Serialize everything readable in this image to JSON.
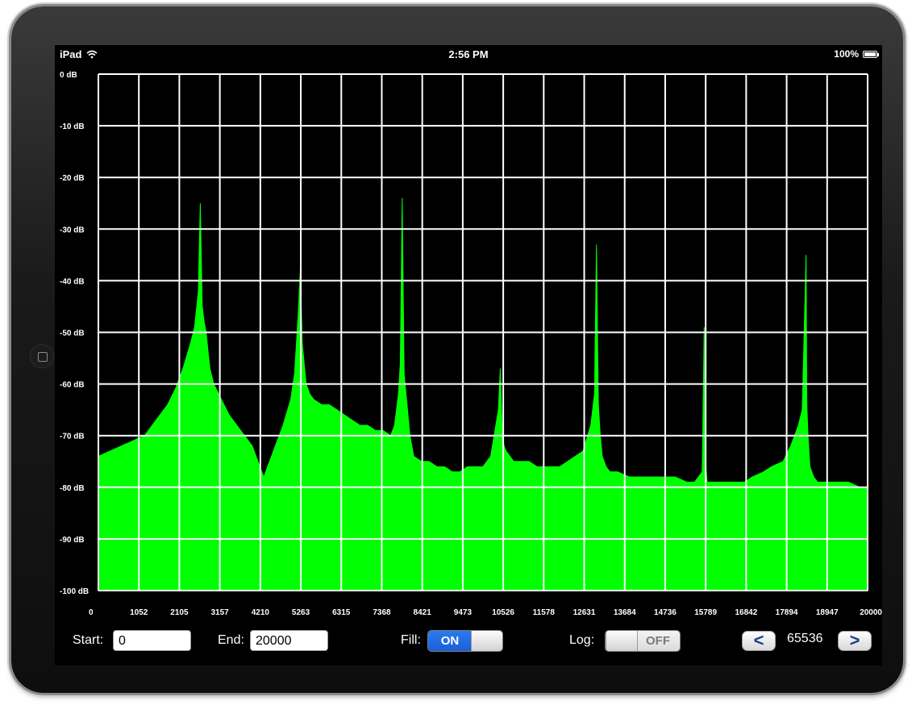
{
  "status_bar": {
    "device": "iPad",
    "time": "2:56 PM",
    "battery": "100%"
  },
  "colors": {
    "spectrum_fill": "#00ff00",
    "grid": "#ffffff",
    "background": "#000000",
    "switch_on": "#1f6ee0"
  },
  "chart_data": {
    "type": "area",
    "title": "",
    "xlabel": "",
    "ylabel": "",
    "xlim": [
      0,
      20000
    ],
    "ylim": [
      -100,
      0
    ],
    "x_ticks": [
      "0",
      "1052",
      "2105",
      "3157",
      "4210",
      "5263",
      "6315",
      "7368",
      "8421",
      "9473",
      "10526",
      "11578",
      "12631",
      "13684",
      "14736",
      "15789",
      "16842",
      "17894",
      "18947",
      "20000"
    ],
    "y_ticks": [
      "0 dB",
      "-10 dB",
      "-20 dB",
      "-30 dB",
      "-40 dB",
      "-50 dB",
      "-60 dB",
      "-70 dB",
      "-80 dB",
      "-90 dB",
      "-100 dB"
    ],
    "grid": true,
    "fill": true,
    "series": [
      {
        "x": [
          0,
          300,
          600,
          900,
          1200,
          1500,
          1800,
          2000,
          2200,
          2400,
          2500,
          2600,
          2650,
          2700,
          2750,
          2800,
          2900,
          3000,
          3200,
          3400,
          3600,
          3800,
          4000,
          4200,
          4300,
          4400,
          4600,
          4800,
          5000,
          5100,
          5200,
          5250,
          5300,
          5350,
          5400,
          5500,
          5600,
          5800,
          6000,
          6200,
          6400,
          6600,
          6800,
          7000,
          7200,
          7400,
          7600,
          7700,
          7800,
          7850,
          7900,
          7950,
          8000,
          8100,
          8200,
          8400,
          8600,
          8800,
          9000,
          9200,
          9400,
          9600,
          9800,
          10000,
          10200,
          10400,
          10450,
          10500,
          10550,
          10600,
          10700,
          10800,
          11000,
          11200,
          11400,
          11600,
          11800,
          12000,
          12200,
          12400,
          12600,
          12800,
          12900,
          12950,
          13000,
          13050,
          13100,
          13200,
          13300,
          13500,
          13800,
          14000,
          14200,
          14500,
          14800,
          15000,
          15300,
          15500,
          15700,
          15750,
          15790,
          15830,
          15900,
          16200,
          16500,
          16800,
          17000,
          17300,
          17500,
          17800,
          18000,
          18200,
          18300,
          18400,
          18420,
          18450,
          18500,
          18600,
          18700,
          18800,
          19000,
          19300,
          19500,
          19800,
          20000
        ],
        "values": [
          -74,
          -73,
          -72,
          -71,
          -70,
          -67,
          -64,
          -61,
          -57,
          -52,
          -49,
          -42,
          -25,
          -45,
          -48,
          -50,
          -57,
          -60,
          -63,
          -66,
          -68,
          -70,
          -72,
          -76,
          -78,
          -76,
          -72,
          -68,
          -63,
          -58,
          -46,
          -38,
          -52,
          -56,
          -60,
          -62,
          -63,
          -64,
          -64,
          -65,
          -66,
          -67,
          -68,
          -68,
          -69,
          -69,
          -70,
          -68,
          -62,
          -56,
          -24,
          -58,
          -62,
          -70,
          -74,
          -75,
          -75,
          -76,
          -76,
          -77,
          -77,
          -76,
          -76,
          -76,
          -74,
          -65,
          -57,
          -70,
          -72,
          -73,
          -74,
          -75,
          -75,
          -75,
          -76,
          -76,
          -76,
          -76,
          -75,
          -74,
          -73,
          -68,
          -62,
          -33,
          -64,
          -70,
          -74,
          -76,
          -77,
          -77,
          -78,
          -78,
          -78,
          -78,
          -78,
          -78,
          -79,
          -79,
          -77,
          -49,
          -76,
          -79,
          -79,
          -79,
          -79,
          -79,
          -78,
          -77,
          -76,
          -75,
          -72,
          -68,
          -65,
          -35,
          -64,
          -70,
          -76,
          -78,
          -79,
          -79,
          -79,
          -79,
          -79,
          -80,
          -80
        ]
      }
    ]
  },
  "controls": {
    "start_label": "Start:",
    "start_value": "0",
    "end_label": "End:",
    "end_value": "20000",
    "fill_label": "Fill:",
    "fill_state": "ON",
    "log_label": "Log:",
    "log_state": "OFF",
    "prev_label": "<",
    "next_label": ">",
    "fft_size": "65536"
  }
}
